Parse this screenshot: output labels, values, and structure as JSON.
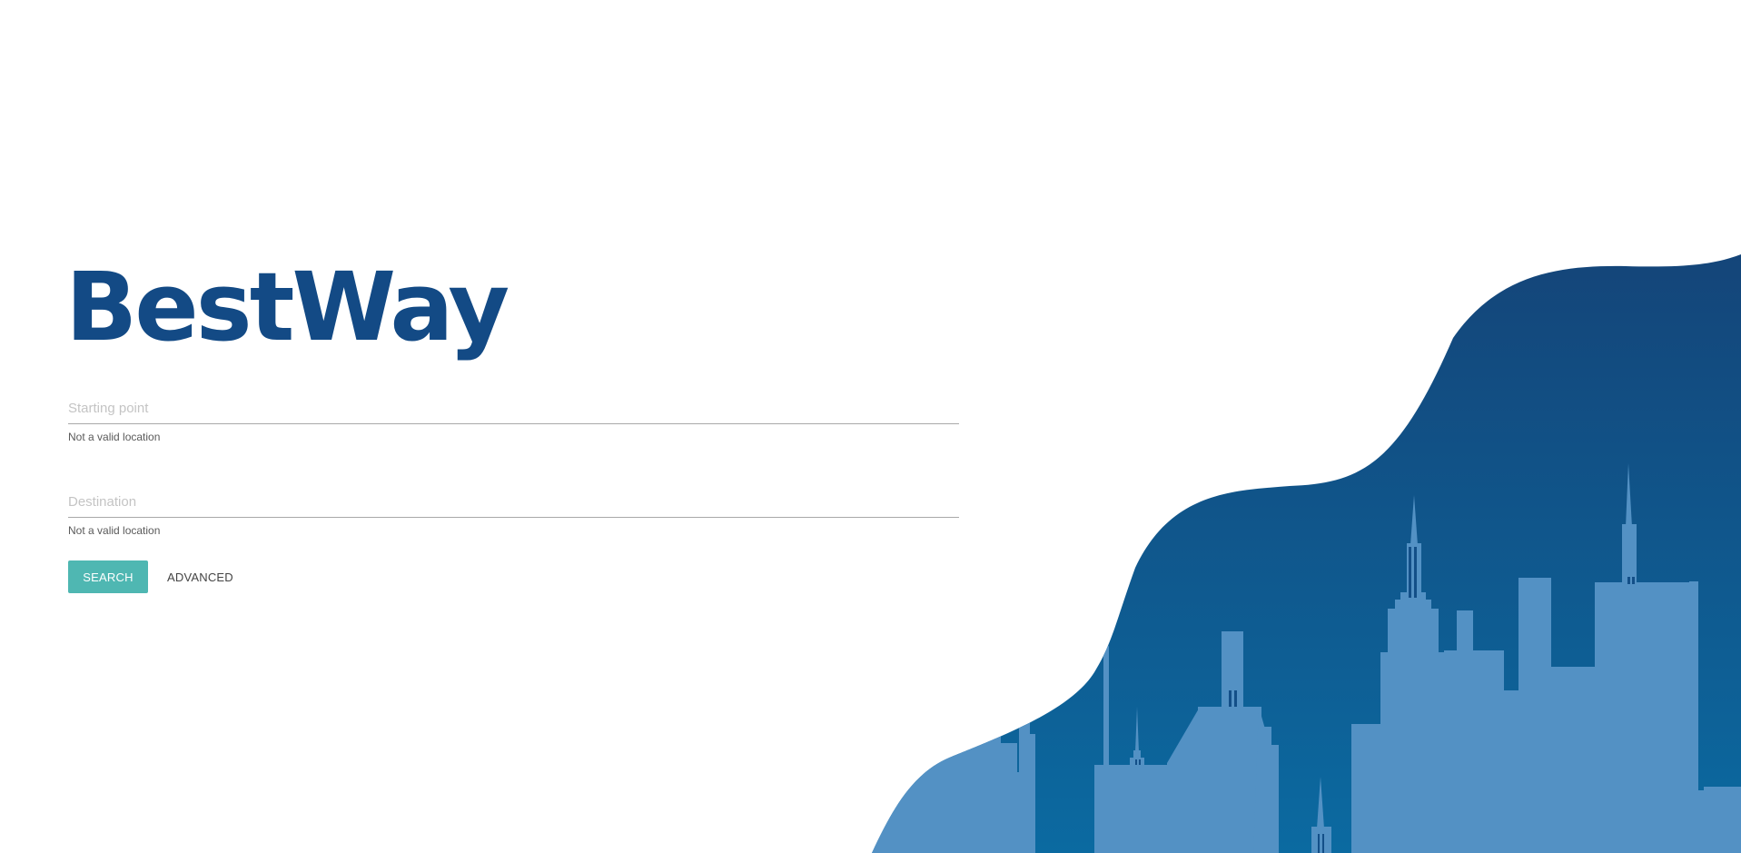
{
  "brand": {
    "name": "BestWay"
  },
  "form": {
    "start": {
      "placeholder": "Starting point",
      "value": "",
      "error": "Not a valid location"
    },
    "destination": {
      "placeholder": "Destination",
      "value": "",
      "error": "Not a valid location"
    }
  },
  "actions": {
    "search_label": "SEARCH",
    "advanced_label": "ADVANCED"
  },
  "colors": {
    "brand": "#134a85",
    "accent": "#4fb7b2",
    "wave_top": "#144579",
    "wave_bottom": "#0b6aa1",
    "skyline": "#5391c4"
  },
  "decor": {
    "hero_illustration": "city-skyline-wave"
  }
}
